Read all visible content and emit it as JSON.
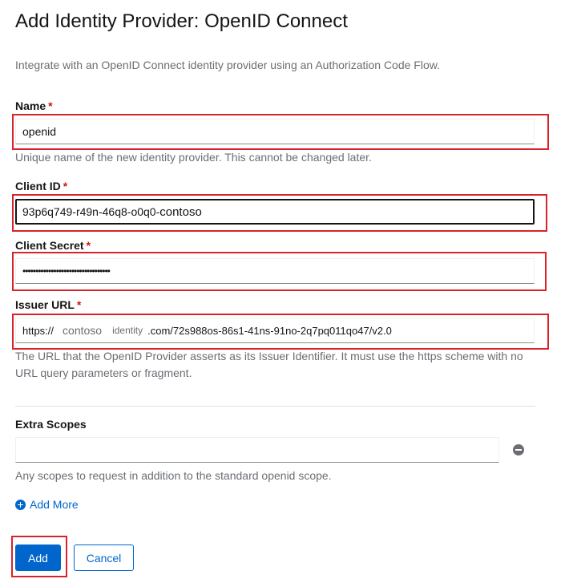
{
  "page": {
    "title": "Add Identity Provider: OpenID Connect",
    "subtitle": "Integrate with an OpenID Connect identity provider using an Authorization Code Flow."
  },
  "form": {
    "required_marker": "*",
    "name": {
      "label": "Name",
      "value": "openid",
      "helper": "Unique name of the new identity provider. This cannot be changed later."
    },
    "client_id": {
      "label": "Client ID",
      "value_prefix": "93p6q749-r49n-46q8-o0q0-",
      "value_suffix": "contoso"
    },
    "client_secret": {
      "label": "Client Secret",
      "value": "••••••••••••••••••••••••••••••••••"
    },
    "issuer_url": {
      "label": "Issuer URL",
      "value_parts": [
        "https://",
        "contoso",
        "identity",
        ".com/72s988os-86s1-41ns-91no-2q7pq011qo47/v2.0"
      ],
      "helper": "The URL that the OpenID Provider asserts as its Issuer Identifier. It must use the https scheme with no URL query parameters or fragment."
    },
    "extra_scopes": {
      "label": "Extra Scopes",
      "value": "",
      "helper": "Any scopes to request in addition to the standard openid scope."
    },
    "add_more_label": "Add More"
  },
  "actions": {
    "add_label": "Add",
    "cancel_label": "Cancel"
  },
  "colors": {
    "primary": "#0066cc",
    "required": "#c9190b",
    "highlight": "#d8232a"
  },
  "icons": {
    "remove": "minus-circle-icon",
    "add": "plus-circle-icon"
  }
}
